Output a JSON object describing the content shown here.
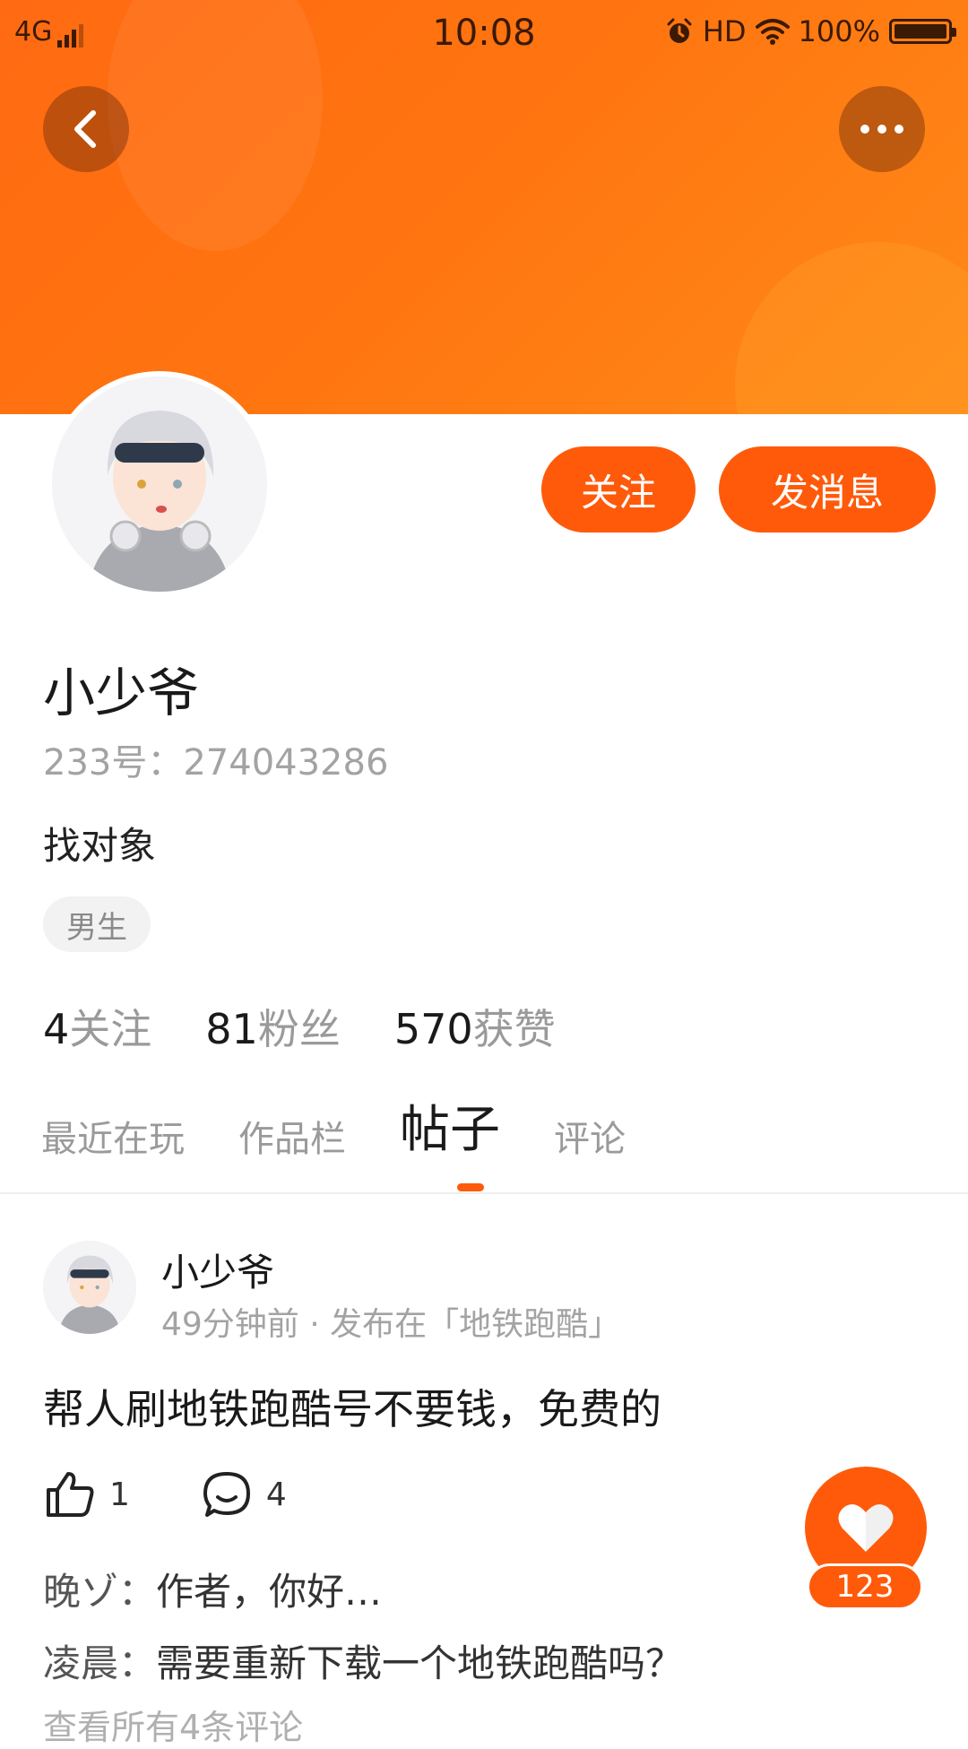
{
  "status_bar": {
    "network": "4G",
    "time": "10:08",
    "hd": "HD",
    "battery": "100%"
  },
  "profile": {
    "name": "小少爷",
    "uid": "233号：274043286",
    "bio": "找对象",
    "gender_tag": "男生",
    "follow_label": "关注",
    "message_label": "发消息",
    "stats": [
      {
        "value": "4",
        "label": "关注"
      },
      {
        "value": "81",
        "label": "粉丝"
      },
      {
        "value": "570",
        "label": "获赞"
      }
    ]
  },
  "tabs": [
    {
      "label": "最近在玩",
      "active": false
    },
    {
      "label": "作品栏",
      "active": false
    },
    {
      "label": "帖子",
      "active": true
    },
    {
      "label": "评论",
      "active": false
    }
  ],
  "post": {
    "author": "小少爷",
    "meta": "49分钟前 · 发布在「地铁跑酷」",
    "text": "帮人刷地铁跑酷号不要钱，免费的",
    "likes": "1",
    "comments_count": "4",
    "comments": [
      {
        "name": "晚ゾ：",
        "text": "作者，你好…"
      },
      {
        "name": "凌晨：",
        "text": "需要重新下载一个地铁跑酷吗？"
      }
    ],
    "view_all": "查看所有4条评论"
  },
  "fab": {
    "count": "123"
  },
  "colors": {
    "accent": "#ff5a0a",
    "banner": "#ff7410"
  },
  "icons": [
    "back-icon",
    "more-icon",
    "like-icon",
    "comment-icon",
    "heart-icon"
  ]
}
